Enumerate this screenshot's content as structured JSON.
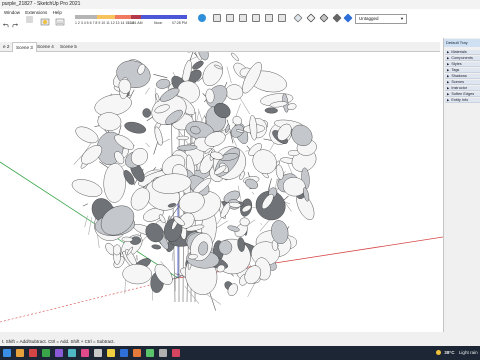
{
  "window": {
    "title": "purple_21827 - SketchUp Pro 2021"
  },
  "menu": {
    "items": [
      "Window",
      "Extensions",
      "Help"
    ]
  },
  "toolbar": {
    "palette_labels": [
      "1 2 3 4 5 6 7 8 9 10 11 12 13 14 15 16",
      "11:51 AM",
      "Noon",
      "07:28 PM"
    ],
    "tag_value": "Untagged"
  },
  "scenes": {
    "tabs": [
      "e 2",
      "Scene 3",
      "Scene 4",
      "Scene 5"
    ],
    "active_index": 1
  },
  "tray": {
    "title": "Default Tray",
    "items": [
      "Materials",
      "Components",
      "Styles",
      "Tags",
      "Shadows",
      "Scenes",
      "Instructor",
      "Soften Edges",
      "Entity Info"
    ]
  },
  "status": {
    "hint": "t. Shift = Add/Subtract. Ctrl = Add. Shift + Ctrl = Subtract."
  },
  "taskbar": {
    "temperature": "38°C",
    "weather": "Light rain"
  },
  "colors": {
    "axis_red": "#d64545",
    "axis_green": "#3aa64a",
    "axis_blue": "#3b4fd6",
    "tray_header": "#cfe0f3",
    "taskbar": "#1c2635"
  }
}
